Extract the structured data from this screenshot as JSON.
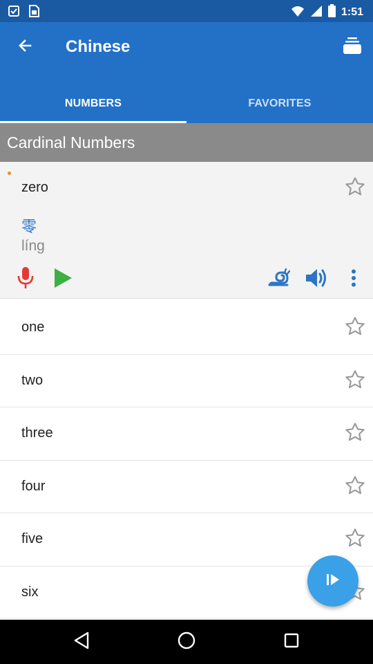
{
  "status_bar": {
    "time": "1:51",
    "icons": [
      "notification-icon",
      "sim-icon",
      "wifi-icon",
      "signal-icon",
      "battery-icon"
    ]
  },
  "app_bar": {
    "title": "Chinese",
    "background": "#2271c7",
    "status_background": "#1a5aa3"
  },
  "tabs": [
    {
      "label": "NUMBERS",
      "active": true
    },
    {
      "label": "FAVORITES",
      "active": false
    }
  ],
  "section": {
    "title": "Cardinal Numbers"
  },
  "expanded_item": {
    "word": "zero",
    "hanzi": "零",
    "pinyin": "líng",
    "controls": [
      "microphone-icon",
      "play-icon",
      "slow-snail-icon",
      "speaker-icon",
      "more-vert-icon"
    ]
  },
  "items": [
    {
      "word": "one"
    },
    {
      "word": "two"
    },
    {
      "word": "three"
    },
    {
      "word": "four"
    },
    {
      "word": "five"
    },
    {
      "word": "six"
    }
  ],
  "fab": {
    "icon": "play-next-icon",
    "color": "#3aa0e8"
  },
  "nav": [
    "back-icon",
    "home-icon",
    "recents-icon"
  ]
}
